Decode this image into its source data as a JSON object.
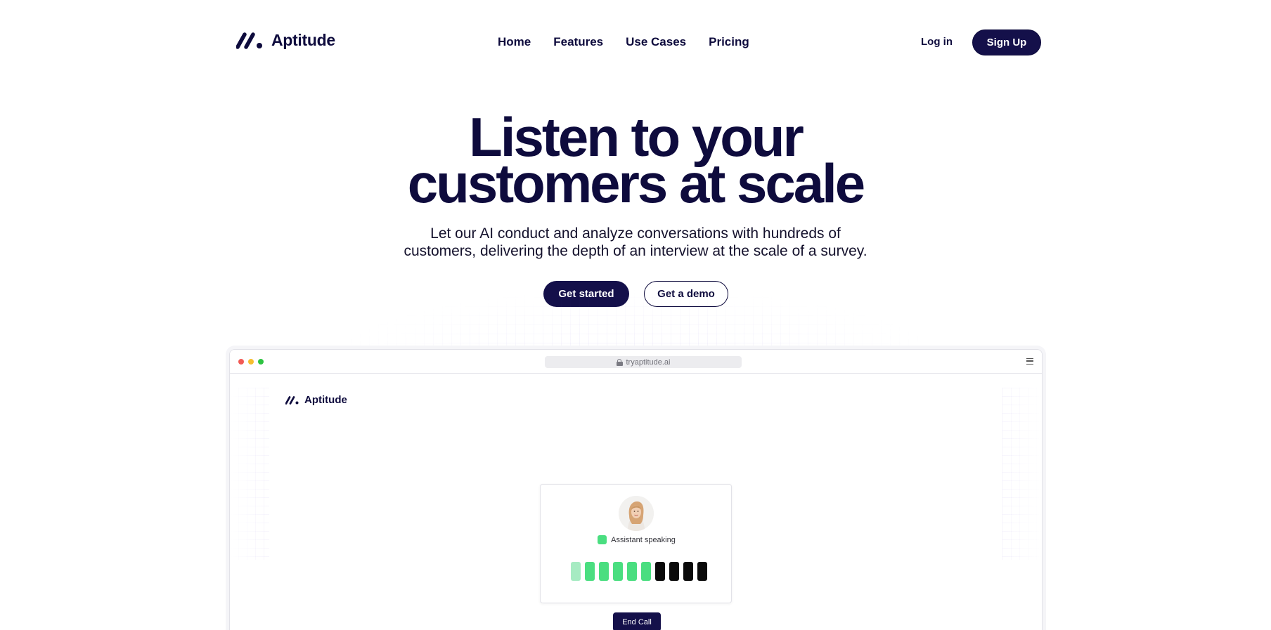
{
  "brand": {
    "name": "Aptitude"
  },
  "nav": {
    "links": [
      "Home",
      "Features",
      "Use Cases",
      "Pricing"
    ],
    "login": "Log in",
    "signup": "Sign Up"
  },
  "hero": {
    "title_lines": [
      "Listen to your",
      "customers at scale"
    ],
    "subtitle_lines": [
      "Let our AI conduct and analyze conversations with hundreds of",
      "customers, delivering the depth of an interview at the scale of a survey."
    ],
    "cta_primary": "Get started",
    "cta_secondary": "Get a demo"
  },
  "browser": {
    "url": "tryaptitude.ai",
    "app_name": "Aptitude",
    "call": {
      "status": "Assistant speaking",
      "end_call": "End Call",
      "level_bars_total": 10,
      "level_bars_active": 6
    }
  },
  "colors": {
    "brand_navy": "#14104a",
    "text_navy": "#0e0b3d",
    "status_green": "#4ade80"
  }
}
